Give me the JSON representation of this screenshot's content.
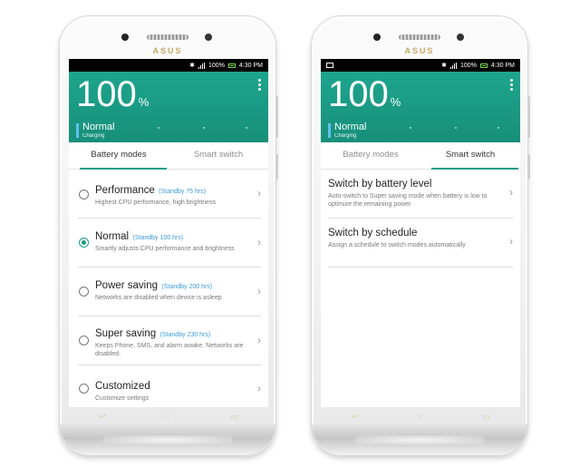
{
  "brand": "ASUS",
  "status": {
    "battery": "100%",
    "time": "4:30 PM"
  },
  "header": {
    "percent": "100",
    "percent_sign": "%",
    "mode": "Normal",
    "state": "Charging"
  },
  "tabs": [
    "Battery modes",
    "Smart switch"
  ],
  "battery_modes": [
    {
      "title": "Performance",
      "standby": "(Standby 75 hrs)",
      "desc": "Highest CPU performance, high brightness",
      "selected": false
    },
    {
      "title": "Normal",
      "standby": "(Standby 100 hrs)",
      "desc": "Smartly adjusts CPU performance and brightness",
      "selected": true
    },
    {
      "title": "Power saving",
      "standby": "(Standby 200 hrs)",
      "desc": "Networks are disabled when device is asleep",
      "selected": false
    },
    {
      "title": "Super saving",
      "standby": "(Standby 230 hrs)",
      "desc": "Keeps Phone, SMS, and alarm awake. Networks are disabled.",
      "selected": false
    },
    {
      "title": "Customized",
      "standby": "",
      "desc": "Customize settings",
      "selected": false
    }
  ],
  "smart_switch": [
    {
      "title": "Switch by battery level",
      "desc": "Auto-switch to Super saving mode when battery is low to optimize the remaining power"
    },
    {
      "title": "Switch by schedule",
      "desc": "Assign a schedule to switch modes automatically"
    }
  ],
  "colors": {
    "accent": "#1b9c86",
    "standby": "#3a9bd9",
    "brand": "#c8a86a"
  },
  "icons": {
    "back": "back-icon",
    "home": "home-icon",
    "recents": "recents-icon",
    "menu": "overflow-menu-icon",
    "bluetooth": "bluetooth-icon",
    "signal": "signal-icon",
    "battery": "battery-icon"
  }
}
